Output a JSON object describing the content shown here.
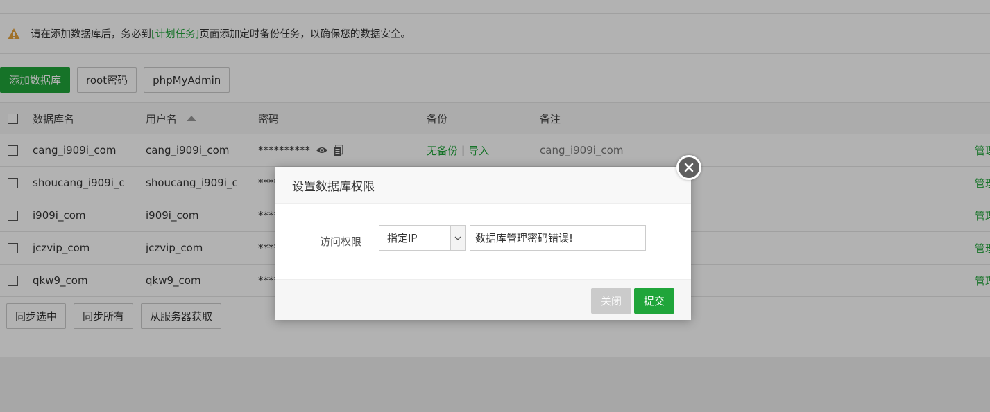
{
  "notice": {
    "text_before": "请在添加数据库后，务必到",
    "link": "[计划任务]",
    "text_after": "页面添加定时备份任务，以确保您的数据安全。"
  },
  "toolbar": {
    "add_db": "添加数据库",
    "root_pw": "root密码",
    "phpmyadmin": "phpMyAdmin"
  },
  "table": {
    "headers": {
      "name": "数据库名",
      "user": "用户名",
      "password": "密码",
      "backup": "备份",
      "note": "备注"
    },
    "rows": [
      {
        "name": "cang_i909i_com",
        "user": "cang_i909i_com",
        "password": "**********",
        "backup_none": "无备份",
        "sep": "|",
        "import": "导入",
        "note": "cang_i909i_com",
        "op": "管理"
      },
      {
        "name": "shoucang_i909i_c",
        "user": "shoucang_i909i_c",
        "password": "****",
        "op": "管理"
      },
      {
        "name": "i909i_com",
        "user": "i909i_com",
        "password": "****",
        "op": "管理"
      },
      {
        "name": "jczvip_com",
        "user": "jczvip_com",
        "password": "****",
        "op": "管理"
      },
      {
        "name": "qkw9_com",
        "user": "qkw9_com",
        "password": "****",
        "op": "管理"
      }
    ]
  },
  "bottom": {
    "sync_selected": "同步选中",
    "sync_all": "同步所有",
    "fetch_server": "从服务器获取"
  },
  "modal": {
    "title": "设置数据库权限",
    "access_label": "访问权限",
    "select_value": "指定IP",
    "input_value": "数据库管理密码错误!",
    "close_label": "关闭",
    "submit_label": "提交"
  },
  "colors": {
    "accent": "#20a53a",
    "warning": "#e6a23c"
  }
}
